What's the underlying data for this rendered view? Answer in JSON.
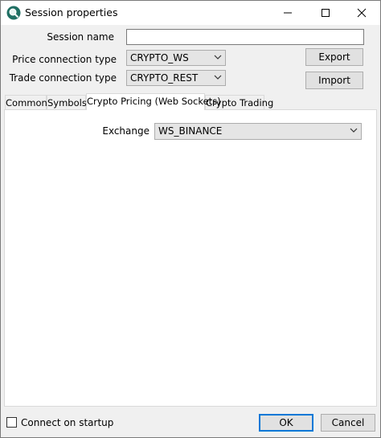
{
  "window": {
    "title": "Session properties"
  },
  "titlebar": {
    "minimize_icon": "minimize-icon",
    "maximize_icon": "maximize-icon",
    "close_icon": "close-icon"
  },
  "form": {
    "session_name_label": "Session name",
    "session_name_value": "",
    "price_connection_label": "Price connection type",
    "price_connection_value": "CRYPTO_WS",
    "trade_connection_label": "Trade connection type",
    "trade_connection_value": "CRYPTO_REST"
  },
  "buttons": {
    "export": "Export",
    "import": "Import",
    "ok": "OK",
    "cancel": "Cancel"
  },
  "tabs": [
    {
      "label": "Common"
    },
    {
      "label": "Symbols"
    },
    {
      "label": "Crypto Pricing (Web Sockets)"
    },
    {
      "label": "Crypto Trading"
    }
  ],
  "active_tab": "Crypto Pricing (Web Sockets)",
  "panel": {
    "exchange_label": "Exchange",
    "exchange_value": "WS_BINANCE"
  },
  "footer": {
    "connect_on_startup_label": "Connect on startup",
    "connect_on_startup_checked": false
  }
}
